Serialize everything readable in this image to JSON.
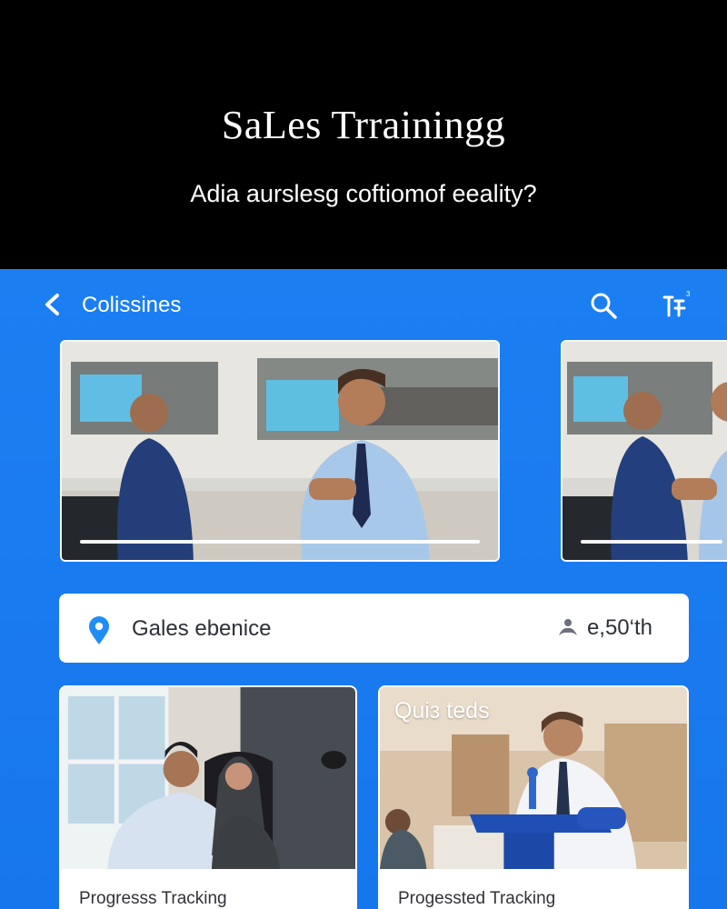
{
  "hero": {
    "title": "SaLes Trrainingg",
    "subtitle": "Adia aurslesg coftiomof eeality?"
  },
  "topbar": {
    "title": "Colissines",
    "icons": [
      "chevron-left-icon",
      "search-icon",
      "filter-icon"
    ]
  },
  "carousel": {
    "slides": [
      {
        "progress": 1.0
      },
      {
        "progress": 1.0
      }
    ]
  },
  "location": {
    "name": "Gales ebenice",
    "meta": "e,50‘th",
    "icons": [
      "location-pin-icon",
      "person-icon"
    ]
  },
  "cards": [
    {
      "overlay": "",
      "label": "Progresss Tracking"
    },
    {
      "overlay": "Quiз teds",
      "label": "Progessted Tracking"
    }
  ],
  "colors": {
    "background": "#1a7ef0",
    "hero": "#000000",
    "accent": "#1f8df5",
    "card": "#ffffff"
  }
}
